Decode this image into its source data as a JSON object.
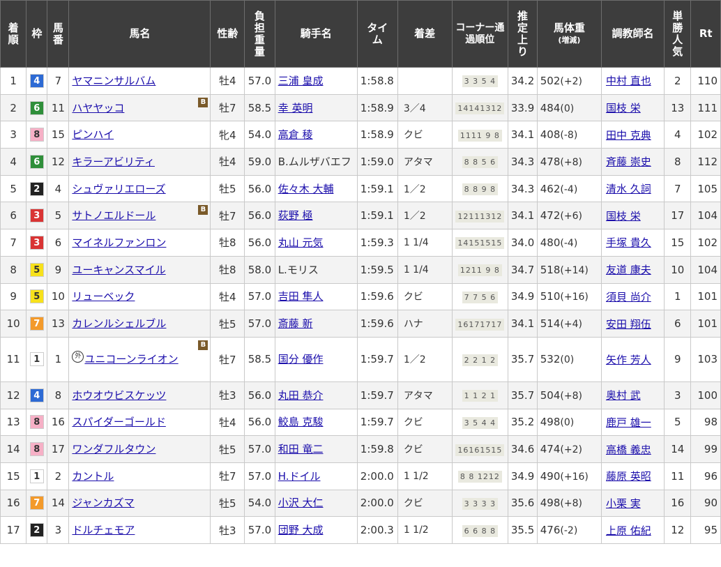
{
  "headers": {
    "chakujun": "着順",
    "waku": "枠",
    "umaban": "馬番",
    "horse": "馬名",
    "sexage": "性齢",
    "weight": "負担重量",
    "jockey": "騎手名",
    "time": "タイム",
    "margin": "着差",
    "corner": "コーナー通過順位",
    "last3f": "推定上り",
    "bodyweight": "馬体重",
    "bodyweight_sub": "(増減)",
    "trainer": "調教師名",
    "popularity": "単勝人気",
    "rt": "Rt"
  },
  "blinker_label": "B",
  "foreign_label": "外",
  "waku_colors": {
    "1": {
      "bg": "#ffffff",
      "fg": "#333333"
    },
    "2": {
      "bg": "#222222",
      "fg": "#ffffff"
    },
    "3": {
      "bg": "#d93434",
      "fg": "#ffffff"
    },
    "4": {
      "bg": "#2d6ad4",
      "fg": "#ffffff"
    },
    "5": {
      "bg": "#f7e11b",
      "fg": "#333333"
    },
    "6": {
      "bg": "#2f8f3a",
      "fg": "#ffffff"
    },
    "7": {
      "bg": "#f39a2b",
      "fg": "#ffffff"
    },
    "8": {
      "bg": "#f6b0c6",
      "fg": "#333333"
    }
  },
  "rows": [
    {
      "pos": "1",
      "waku": "4",
      "num": "7",
      "horse": "ヤマニンサルバム",
      "blinker": false,
      "foreign": false,
      "sexage": "牡4",
      "weight": "57.0",
      "jockey": "三浦 皇成",
      "time": "1:58.8",
      "margin": "",
      "corner": "3 3 5 4",
      "last3f": "34.2",
      "bw": "502",
      "bwd": "(+2)",
      "trainer": "中村 直也",
      "pop": "2",
      "rt": "110"
    },
    {
      "pos": "2",
      "waku": "6",
      "num": "11",
      "horse": "ハヤヤッコ",
      "blinker": true,
      "foreign": false,
      "sexage": "牡7",
      "weight": "58.5",
      "jockey": "幸 英明",
      "time": "1:58.9",
      "margin": "3／4",
      "corner": "14141312",
      "last3f": "33.9",
      "bw": "484",
      "bwd": "(0)",
      "trainer": "国枝 栄",
      "pop": "13",
      "rt": "111"
    },
    {
      "pos": "3",
      "waku": "8",
      "num": "15",
      "horse": "ピンハイ",
      "blinker": false,
      "foreign": false,
      "sexage": "牝4",
      "weight": "54.0",
      "jockey": "高倉 稜",
      "time": "1:58.9",
      "margin": "クビ",
      "corner": "1111 9 8",
      "last3f": "34.1",
      "bw": "408",
      "bwd": "(-8)",
      "trainer": "田中 克典",
      "pop": "4",
      "rt": "102"
    },
    {
      "pos": "4",
      "waku": "6",
      "num": "12",
      "horse": "キラーアビリティ",
      "blinker": false,
      "foreign": false,
      "sexage": "牡4",
      "weight": "59.0",
      "jockey": "B.ムルザバエフ",
      "jockey_link": false,
      "time": "1:59.0",
      "margin": "アタマ",
      "corner": "8 8 5 6",
      "last3f": "34.3",
      "bw": "478",
      "bwd": "(+8)",
      "trainer": "斉藤 崇史",
      "pop": "8",
      "rt": "112"
    },
    {
      "pos": "5",
      "waku": "2",
      "num": "4",
      "horse": "シュヴァリエローズ",
      "blinker": false,
      "foreign": false,
      "sexage": "牡5",
      "weight": "56.0",
      "jockey": "佐々木 大輔",
      "time": "1:59.1",
      "margin": "1／2",
      "corner": "8 8 9 8",
      "last3f": "34.3",
      "bw": "462",
      "bwd": "(-4)",
      "trainer": "清水 久詞",
      "pop": "7",
      "rt": "105"
    },
    {
      "pos": "6",
      "waku": "3",
      "num": "5",
      "horse": "サトノエルドール",
      "blinker": true,
      "foreign": false,
      "sexage": "牡7",
      "weight": "56.0",
      "jockey": "荻野 極",
      "time": "1:59.1",
      "margin": "1／2",
      "corner": "12111312",
      "last3f": "34.1",
      "bw": "472",
      "bwd": "(+6)",
      "trainer": "国枝 栄",
      "pop": "17",
      "rt": "104"
    },
    {
      "pos": "7",
      "waku": "3",
      "num": "6",
      "horse": "マイネルファンロン",
      "blinker": false,
      "foreign": false,
      "sexage": "牡8",
      "weight": "56.0",
      "jockey": "丸山 元気",
      "time": "1:59.3",
      "margin": "1 1/4",
      "corner": "14151515",
      "last3f": "34.0",
      "bw": "480",
      "bwd": "(-4)",
      "trainer": "手塚 貴久",
      "pop": "15",
      "rt": "102"
    },
    {
      "pos": "8",
      "waku": "5",
      "num": "9",
      "horse": "ユーキャンスマイル",
      "blinker": false,
      "foreign": false,
      "sexage": "牡8",
      "weight": "58.0",
      "jockey": "L.モリス",
      "jockey_link": false,
      "time": "1:59.5",
      "margin": "1 1/4",
      "corner": "1211 9 8",
      "last3f": "34.7",
      "bw": "518",
      "bwd": "(+14)",
      "trainer": "友道 康夫",
      "pop": "10",
      "rt": "104"
    },
    {
      "pos": "9",
      "waku": "5",
      "num": "10",
      "horse": "リューベック",
      "blinker": false,
      "foreign": false,
      "sexage": "牡4",
      "weight": "57.0",
      "jockey": "吉田 隼人",
      "time": "1:59.6",
      "margin": "クビ",
      "corner": "7 7 5 6",
      "last3f": "34.9",
      "bw": "510",
      "bwd": "(+16)",
      "trainer": "須貝 尚介",
      "pop": "1",
      "rt": "101"
    },
    {
      "pos": "10",
      "waku": "7",
      "num": "13",
      "horse": "カレンルシェルブル",
      "blinker": false,
      "foreign": false,
      "sexage": "牡5",
      "weight": "57.0",
      "jockey": "斎藤 新",
      "time": "1:59.6",
      "margin": "ハナ",
      "corner": "16171717",
      "last3f": "34.1",
      "bw": "514",
      "bwd": "(+4)",
      "trainer": "安田 翔伍",
      "pop": "6",
      "rt": "101"
    },
    {
      "pos": "11",
      "waku": "1",
      "num": "1",
      "horse": "ユニコーンライオン",
      "blinker": true,
      "foreign": true,
      "sexage": "牡7",
      "weight": "58.5",
      "jockey": "国分 優作",
      "time": "1:59.7",
      "margin": "1／2",
      "corner": "2 2 1 2",
      "last3f": "35.7",
      "bw": "532",
      "bwd": "(0)",
      "trainer": "矢作 芳人",
      "pop": "9",
      "rt": "103"
    },
    {
      "pos": "12",
      "waku": "4",
      "num": "8",
      "horse": "ホウオウビスケッツ",
      "blinker": false,
      "foreign": false,
      "sexage": "牡3",
      "weight": "56.0",
      "jockey": "丸田 恭介",
      "time": "1:59.7",
      "margin": "アタマ",
      "corner": "1 1 2 1",
      "last3f": "35.7",
      "bw": "504",
      "bwd": "(+8)",
      "trainer": "奥村 武",
      "pop": "3",
      "rt": "100"
    },
    {
      "pos": "13",
      "waku": "8",
      "num": "16",
      "horse": "スパイダーゴールド",
      "blinker": false,
      "foreign": false,
      "sexage": "牡4",
      "weight": "56.0",
      "jockey": "鮫島 克駿",
      "time": "1:59.7",
      "margin": "クビ",
      "corner": "3 5 4 4",
      "last3f": "35.2",
      "bw": "498",
      "bwd": "(0)",
      "trainer": "鹿戸 雄一",
      "pop": "5",
      "rt": "98"
    },
    {
      "pos": "14",
      "waku": "8",
      "num": "17",
      "horse": "ワンダフルタウン",
      "blinker": false,
      "foreign": false,
      "sexage": "牡5",
      "weight": "57.0",
      "jockey": "和田 竜二",
      "time": "1:59.8",
      "margin": "クビ",
      "corner": "16161515",
      "last3f": "34.6",
      "bw": "474",
      "bwd": "(+2)",
      "trainer": "高橋 義忠",
      "pop": "14",
      "rt": "99"
    },
    {
      "pos": "15",
      "waku": "1",
      "num": "2",
      "horse": "カントル",
      "blinker": false,
      "foreign": false,
      "sexage": "牡7",
      "weight": "57.0",
      "jockey": "H.ドイル",
      "time": "2:00.0",
      "margin": "1 1/2",
      "corner": "8 8 1212",
      "last3f": "34.9",
      "bw": "490",
      "bwd": "(+16)",
      "trainer": "藤原 英昭",
      "pop": "11",
      "rt": "96"
    },
    {
      "pos": "16",
      "waku": "7",
      "num": "14",
      "horse": "ジャンカズマ",
      "blinker": false,
      "foreign": false,
      "sexage": "牡5",
      "weight": "54.0",
      "jockey": "小沢 大仁",
      "time": "2:00.0",
      "margin": "クビ",
      "corner": "3 3 3 3",
      "last3f": "35.6",
      "bw": "498",
      "bwd": "(+8)",
      "trainer": "小栗 実",
      "pop": "16",
      "rt": "90"
    },
    {
      "pos": "17",
      "waku": "2",
      "num": "3",
      "horse": "ドルチェモア",
      "blinker": false,
      "foreign": false,
      "sexage": "牡3",
      "weight": "57.0",
      "jockey": "団野 大成",
      "time": "2:00.3",
      "margin": "1 1/2",
      "corner": "6 6 8 8",
      "last3f": "35.5",
      "bw": "476",
      "bwd": "(-2)",
      "trainer": "上原 佑紀",
      "pop": "12",
      "rt": "95"
    }
  ]
}
